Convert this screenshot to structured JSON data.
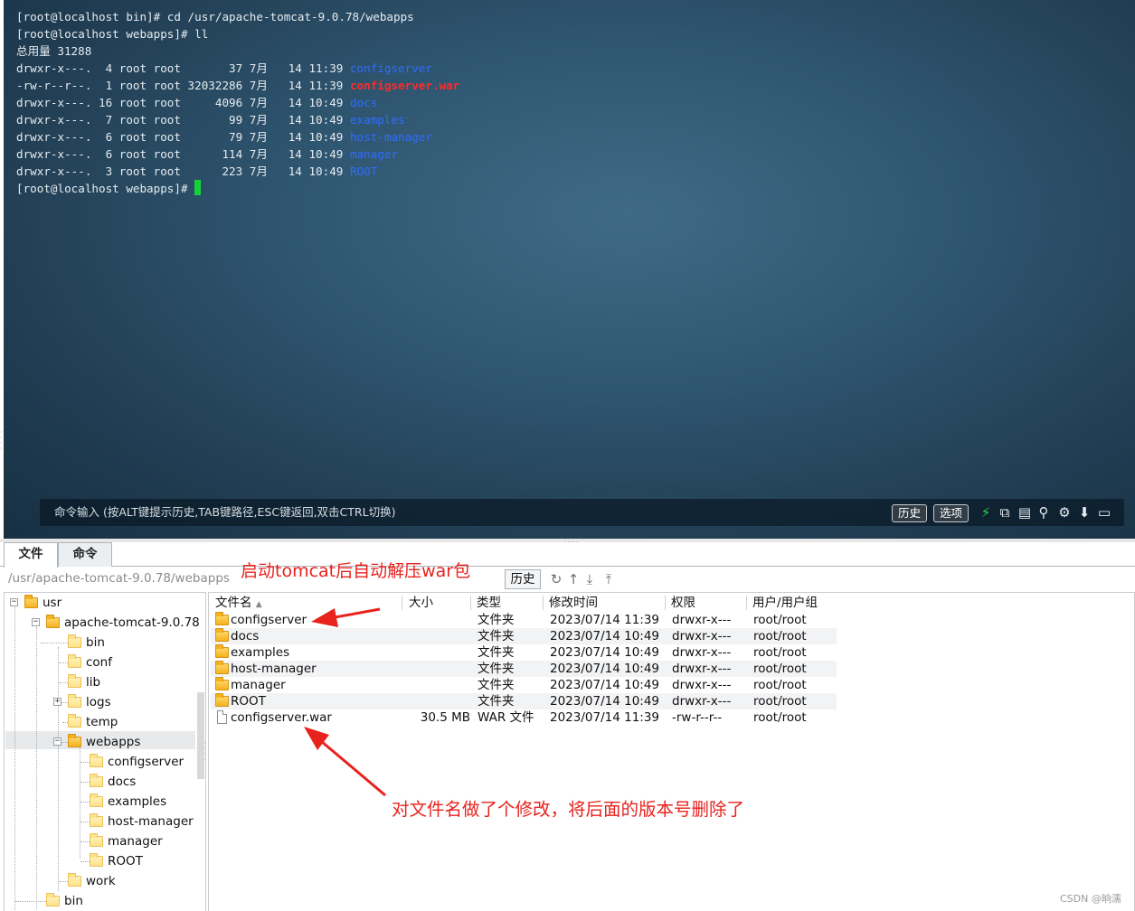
{
  "terminal": {
    "lines": [
      {
        "text": "[root@localhost bin]# cd /usr/apache-tomcat-9.0.78/webapps"
      },
      {
        "text": "[root@localhost webapps]# ll"
      },
      {
        "text": "总用量 31288"
      },
      {
        "text": "drwxr-x---.  4 root root       37 7月   14 11:39 ",
        "name": "configserver",
        "kind": "dir"
      },
      {
        "text": "-rw-r--r--.  1 root root 32032286 7月   14 11:39 ",
        "name": "configserver.war",
        "kind": "war"
      },
      {
        "text": "drwxr-x---. 16 root root     4096 7月   14 10:49 ",
        "name": "docs",
        "kind": "dir"
      },
      {
        "text": "drwxr-x---.  7 root root       99 7月   14 10:49 ",
        "name": "examples",
        "kind": "dir"
      },
      {
        "text": "drwxr-x---.  6 root root       79 7月   14 10:49 ",
        "name": "host-manager",
        "kind": "dir"
      },
      {
        "text": "drwxr-x---.  6 root root      114 7月   14 10:49 ",
        "name": "manager",
        "kind": "dir"
      },
      {
        "text": "drwxr-x---.  3 root root      223 7月   14 10:49 ",
        "name": "ROOT",
        "kind": "dir"
      },
      {
        "text": "[root@localhost webapps]# ",
        "cursor": true
      }
    ],
    "command_hint": "命令输入 (按ALT键提示历史,TAB键路径,ESC键返回,双击CTRL切换)",
    "history_button": "历史",
    "options_button": "选项",
    "icons": [
      "lightning-icon",
      "copy-icon",
      "paste-icon",
      "search-icon",
      "gear-icon",
      "download-icon",
      "window-icon"
    ]
  },
  "tabs": [
    {
      "label": "文件",
      "active": true
    },
    {
      "label": "命令",
      "active": false
    }
  ],
  "path_bar": {
    "path": "/usr/apache-tomcat-9.0.78/webapps",
    "history_button": "历史",
    "icons": [
      "refresh-icon",
      "up-icon",
      "download-icon",
      "upload-icon"
    ]
  },
  "tree": [
    {
      "label": "usr",
      "toggle": "-"
    },
    {
      "label": "apache-tomcat-9.0.78",
      "toggle": "-"
    },
    {
      "label": "bin"
    },
    {
      "label": "conf"
    },
    {
      "label": "lib"
    },
    {
      "label": "logs",
      "toggle": "+"
    },
    {
      "label": "temp"
    },
    {
      "label": "webapps",
      "toggle": "-",
      "selected": true
    },
    {
      "label": "configserver"
    },
    {
      "label": "docs"
    },
    {
      "label": "examples"
    },
    {
      "label": "host-manager"
    },
    {
      "label": "manager"
    },
    {
      "label": "ROOT"
    },
    {
      "label": "work"
    },
    {
      "label": "bin"
    }
  ],
  "file_table": {
    "columns": [
      "文件名",
      "大小",
      "类型",
      "修改时间",
      "权限",
      "用户/用户组"
    ],
    "rows": [
      {
        "name": "configserver",
        "size": "",
        "type": "文件夹",
        "mtime": "2023/07/14 11:39",
        "perm": "drwxr-x---",
        "owner": "root/root",
        "icon": "folder-icon"
      },
      {
        "name": "docs",
        "size": "",
        "type": "文件夹",
        "mtime": "2023/07/14 10:49",
        "perm": "drwxr-x---",
        "owner": "root/root",
        "icon": "folder-icon"
      },
      {
        "name": "examples",
        "size": "",
        "type": "文件夹",
        "mtime": "2023/07/14 10:49",
        "perm": "drwxr-x---",
        "owner": "root/root",
        "icon": "folder-icon"
      },
      {
        "name": "host-manager",
        "size": "",
        "type": "文件夹",
        "mtime": "2023/07/14 10:49",
        "perm": "drwxr-x---",
        "owner": "root/root",
        "icon": "folder-icon"
      },
      {
        "name": "manager",
        "size": "",
        "type": "文件夹",
        "mtime": "2023/07/14 10:49",
        "perm": "drwxr-x---",
        "owner": "root/root",
        "icon": "folder-icon"
      },
      {
        "name": "ROOT",
        "size": "",
        "type": "文件夹",
        "mtime": "2023/07/14 10:49",
        "perm": "drwxr-x---",
        "owner": "root/root",
        "icon": "folder-icon"
      },
      {
        "name": "configserver.war",
        "size": "30.5 MB",
        "type": "WAR 文件",
        "mtime": "2023/07/14 11:39",
        "perm": "-rw-r--r--",
        "owner": "root/root",
        "icon": "file-icon"
      }
    ]
  },
  "annotations": {
    "top": "启动tomcat后自动解压war包",
    "bottom": "对文件名做了个修改，将后面的版本号删除了",
    "color": "#e8221d"
  },
  "watermark": "CSDN @晌濡"
}
